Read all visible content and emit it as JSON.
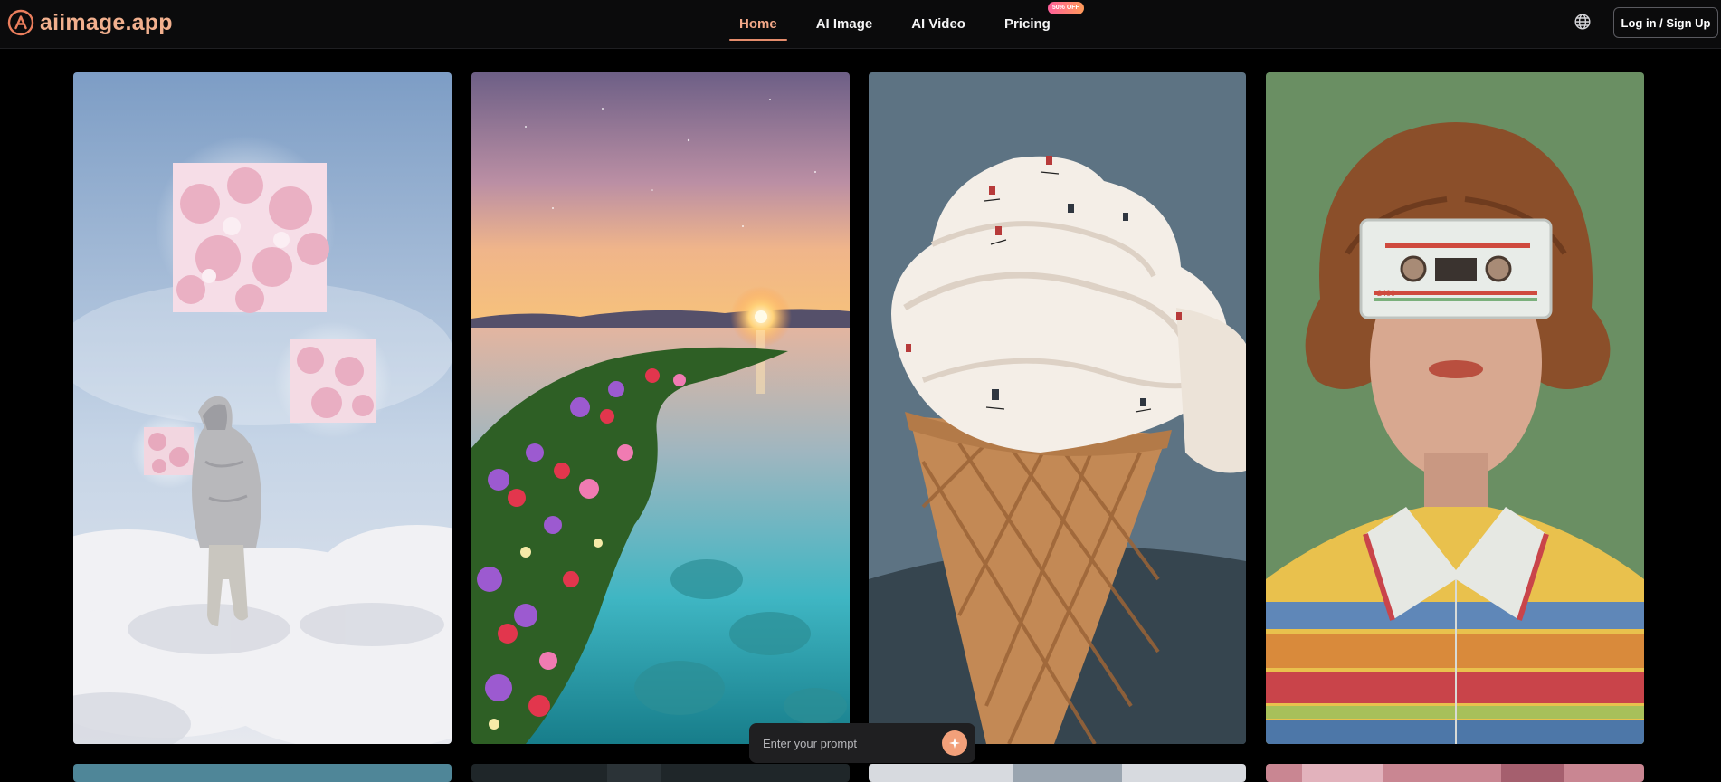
{
  "brand": {
    "name": "aiimage.app",
    "accent": "#f2b08e"
  },
  "nav": {
    "items": [
      {
        "label": "Home",
        "active": true
      },
      {
        "label": "AI Image",
        "active": false
      },
      {
        "label": "AI Video",
        "active": false
      },
      {
        "label": "Pricing",
        "active": false,
        "badge": "50% OFF"
      }
    ]
  },
  "header": {
    "language_icon": "globe-icon",
    "login_label": "Log in / Sign Up"
  },
  "gallery": {
    "tiles": [
      {
        "subject": "hooded figure walking on clouds with floating flower cubes"
      },
      {
        "subject": "sunset over lake with flower-covered shoreline"
      },
      {
        "subject": "miniature skiers on giant ice cream cone"
      },
      {
        "subject": "woman with cassette tape over eyes in striped shirt"
      }
    ],
    "artwork_labels": {
      "cassette_number": "2400"
    }
  },
  "prompt": {
    "placeholder": "Enter your prompt",
    "submit_icon": "sparkle-icon"
  },
  "colors": {
    "background": "#000000",
    "header": "#0b0b0c",
    "active_nav": "#f3a888",
    "cta": "#f2a07a"
  }
}
